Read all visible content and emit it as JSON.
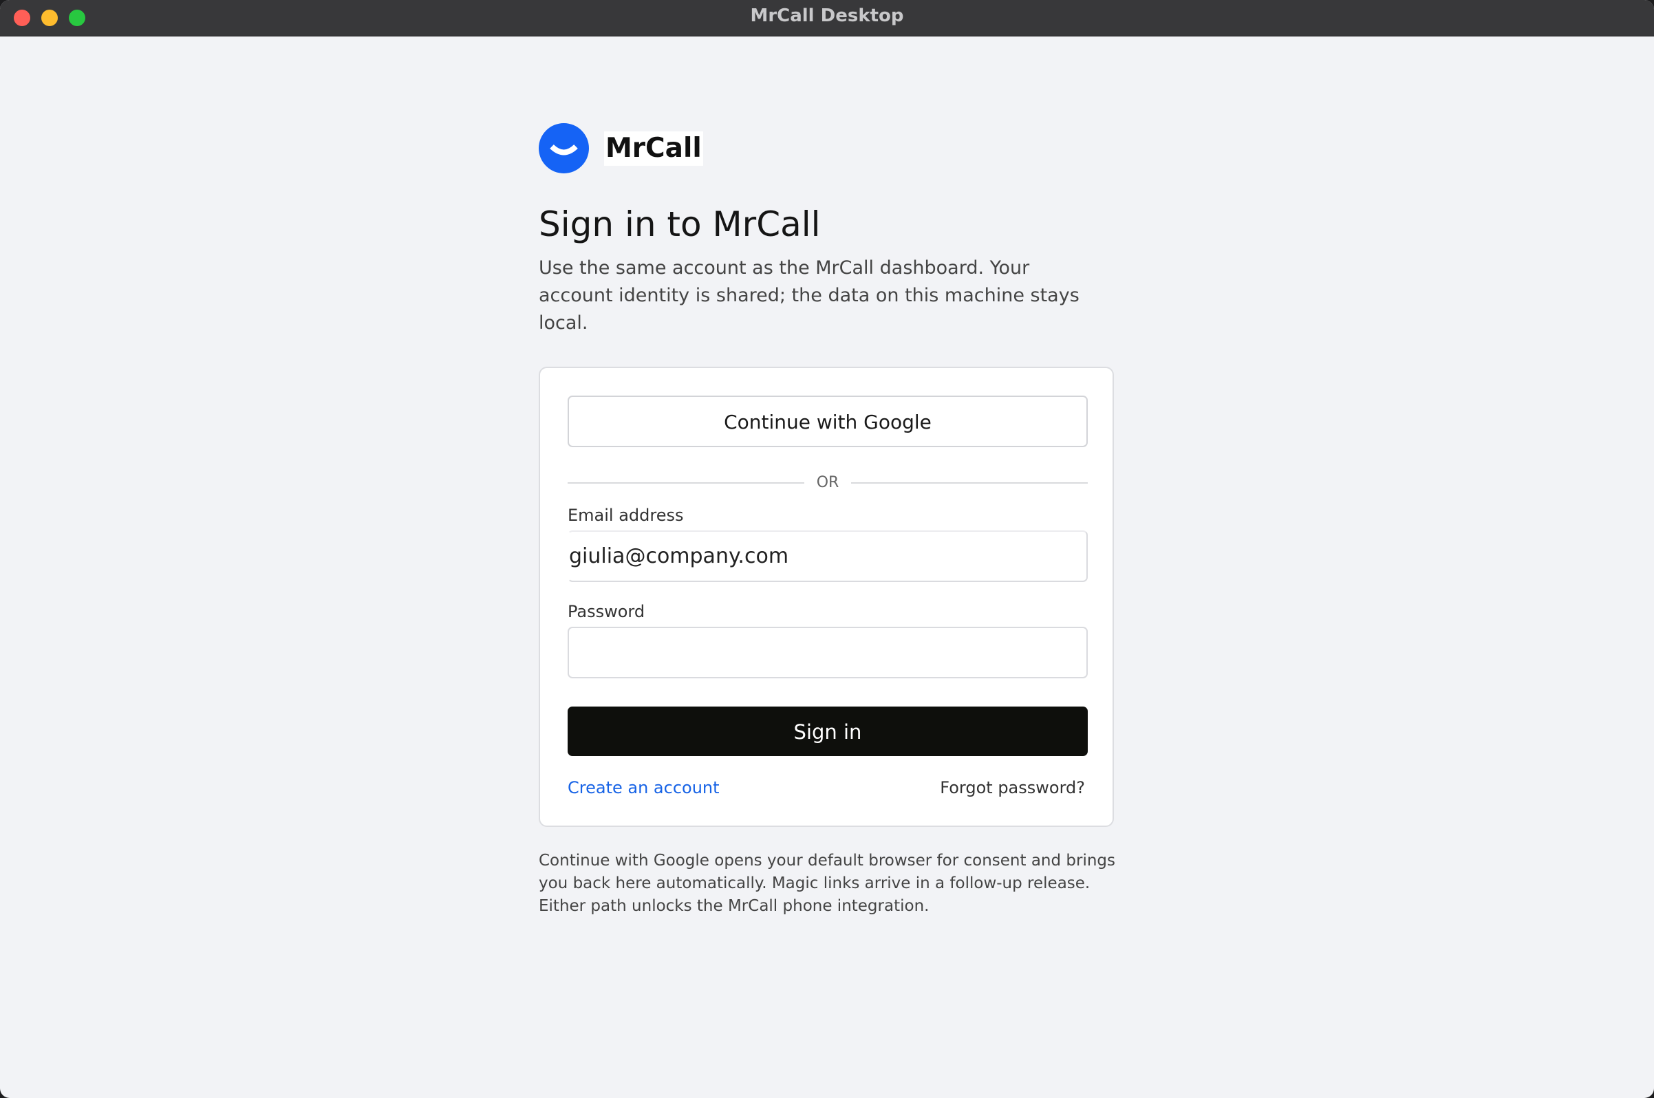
{
  "window": {
    "title": "MrCall Desktop"
  },
  "brand": {
    "name": "MrCall",
    "logo_icon": "smile-logo-icon",
    "color": "#1563f5"
  },
  "header": {
    "title": "Sign in to MrCall",
    "subtitle": "Use the same account as the MrCall dashboard. Your account identity is shared; the data on this machine stays local."
  },
  "form": {
    "google_label": "Continue with Google",
    "divider_label": "OR",
    "email_label": "Email address",
    "email_value": "giulia@company.com",
    "password_label": "Password",
    "password_value": "",
    "signin_label": "Sign in",
    "create_account_label": "Create an account",
    "forgot_password_label": "Forgot password?"
  },
  "footnote": "Continue with Google opens your default browser for consent and brings you back here automatically. Magic links arrive in a follow-up release. Either path unlocks the MrCall phone integration.",
  "colors": {
    "accent_link": "#1763e6",
    "primary_button": "#0e0f0c",
    "background": "#f2f3f6"
  }
}
